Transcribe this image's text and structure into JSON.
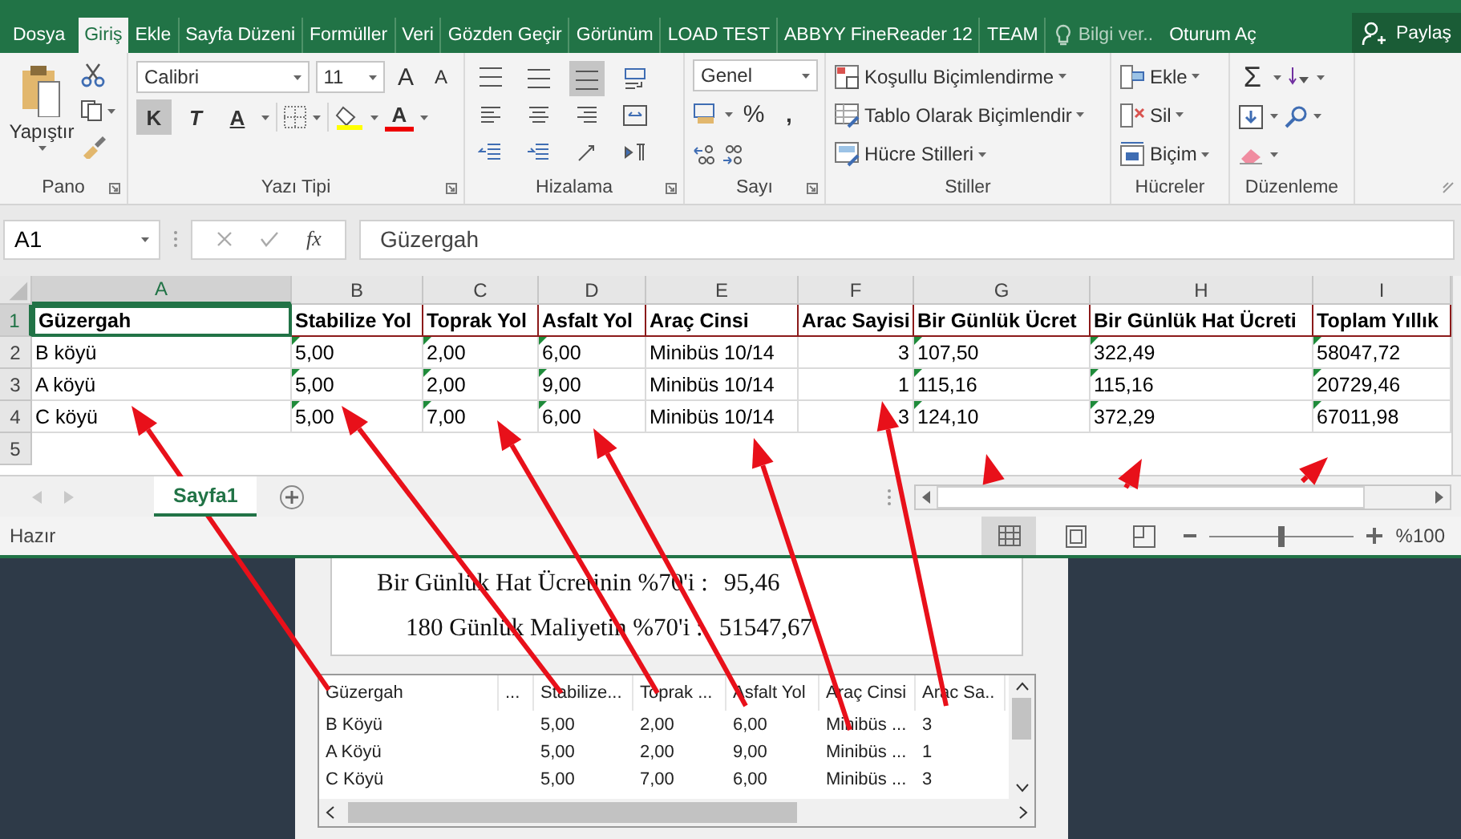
{
  "menu_tabs": [
    {
      "label": "Dosya",
      "selected": false
    },
    {
      "label": "Giriş",
      "selected": true
    },
    {
      "label": "Ekle",
      "selected": false
    },
    {
      "label": "Sayfa Düzeni",
      "selected": false
    },
    {
      "label": "Formüller",
      "selected": false
    },
    {
      "label": "Veri",
      "selected": false
    },
    {
      "label": "Gözden Geçir",
      "selected": false
    },
    {
      "label": "Görünüm",
      "selected": false
    },
    {
      "label": "LOAD TEST",
      "selected": false
    },
    {
      "label": "ABBYY FineReader 12",
      "selected": false
    },
    {
      "label": "TEAM",
      "selected": false
    }
  ],
  "tell_me": {
    "placeholder": "Bilgi ver.."
  },
  "sign_in": "Oturum Aç",
  "share": "Paylaş",
  "ribbon": {
    "clipboard": {
      "paste": "Yapıştır",
      "label": "Pano"
    },
    "font": {
      "family": "Calibri",
      "size": "11",
      "grow": "A",
      "shrink": "A",
      "bold": {
        "text": "K",
        "on": true
      },
      "italic": {
        "text": "T",
        "on": false
      },
      "underline": {
        "text": "A",
        "on": false
      },
      "font_color": "A",
      "label": "Yazı Tipi"
    },
    "alignment": {
      "label": "Hizalama",
      "buttons": [
        {
          "kind": "top",
          "on": false
        },
        {
          "kind": "middle",
          "on": false
        },
        {
          "kind": "bottom",
          "on": true
        },
        {
          "kind": "wrap",
          "on": false
        },
        {
          "kind": "left",
          "on": false
        },
        {
          "kind": "center",
          "on": false
        },
        {
          "kind": "right",
          "on": false
        },
        {
          "kind": "merge",
          "on": false
        },
        {
          "kind": "outdent",
          "on": false
        },
        {
          "kind": "indent",
          "on": false
        },
        {
          "kind": "orientation",
          "on": false
        },
        {
          "kind": "rtl",
          "on": false
        }
      ]
    },
    "number": {
      "format": "Genel",
      "percent": "%",
      "comma": ",",
      "label": "Sayı"
    },
    "styles": {
      "buttons": [
        "Koşullu Biçimlendirme",
        "Tablo Olarak Biçimlendir",
        "Hücre Stilleri"
      ],
      "label": "Stiller"
    },
    "cells": {
      "buttons": [
        "Ekle",
        "Sil",
        "Biçim"
      ],
      "label": "Hücreler"
    },
    "editing": {
      "sum": "Σ",
      "label": "Düzenleme"
    }
  },
  "formula_bar": {
    "name_box": "A1",
    "fx": "fx",
    "value": "Güzergah"
  },
  "sheet": {
    "columns": [
      {
        "label": "A",
        "selected": true
      },
      {
        "label": "B",
        "selected": false
      },
      {
        "label": "C",
        "selected": false
      },
      {
        "label": "D",
        "selected": false
      },
      {
        "label": "E",
        "selected": false
      },
      {
        "label": "F",
        "selected": false
      },
      {
        "label": "G",
        "selected": false
      },
      {
        "label": "H",
        "selected": false
      },
      {
        "label": "I",
        "selected": false
      }
    ],
    "rows": [
      {
        "number": "1",
        "selected": true,
        "kind": "header",
        "cells": [
          {
            "text": "Güzergah",
            "flag": false,
            "kind": "text"
          },
          {
            "text": "Stabilize Yol",
            "flag": false,
            "kind": "text"
          },
          {
            "text": "Toprak Yol",
            "flag": false,
            "kind": "text"
          },
          {
            "text": "Asfalt Yol",
            "flag": false,
            "kind": "text"
          },
          {
            "text": "Araç Cinsi",
            "flag": false,
            "kind": "text"
          },
          {
            "text": "Arac Sayisi",
            "flag": false,
            "kind": "text"
          },
          {
            "text": "Bir Günlük Ücret",
            "flag": false,
            "kind": "text"
          },
          {
            "text": "Bir Günlük Hat Ücreti",
            "flag": false,
            "kind": "text"
          },
          {
            "text": "Toplam Yıllık",
            "flag": false,
            "kind": "text"
          }
        ]
      },
      {
        "number": "2",
        "selected": false,
        "kind": "data",
        "cells": [
          {
            "text": "B köyü",
            "flag": false,
            "kind": "text"
          },
          {
            "text": "5,00",
            "flag": true,
            "kind": "text"
          },
          {
            "text": "2,00",
            "flag": true,
            "kind": "text"
          },
          {
            "text": "6,00",
            "flag": true,
            "kind": "text"
          },
          {
            "text": "Minibüs 10/14",
            "flag": false,
            "kind": "text"
          },
          {
            "text": "3",
            "flag": false,
            "kind": "number"
          },
          {
            "text": "107,50",
            "flag": true,
            "kind": "text"
          },
          {
            "text": "322,49",
            "flag": true,
            "kind": "text"
          },
          {
            "text": "58047,72",
            "flag": true,
            "kind": "text"
          }
        ]
      },
      {
        "number": "3",
        "selected": false,
        "kind": "data",
        "cells": [
          {
            "text": "A köyü",
            "flag": false,
            "kind": "text"
          },
          {
            "text": "5,00",
            "flag": true,
            "kind": "text"
          },
          {
            "text": "2,00",
            "flag": true,
            "kind": "text"
          },
          {
            "text": "9,00",
            "flag": true,
            "kind": "text"
          },
          {
            "text": "Minibüs 10/14",
            "flag": false,
            "kind": "text"
          },
          {
            "text": "1",
            "flag": false,
            "kind": "number"
          },
          {
            "text": "115,16",
            "flag": true,
            "kind": "text"
          },
          {
            "text": "115,16",
            "flag": true,
            "kind": "text"
          },
          {
            "text": "20729,46",
            "flag": true,
            "kind": "text"
          }
        ]
      },
      {
        "number": "4",
        "selected": false,
        "kind": "data",
        "cells": [
          {
            "text": "C köyü",
            "flag": false,
            "kind": "text"
          },
          {
            "text": "5,00",
            "flag": true,
            "kind": "text"
          },
          {
            "text": "7,00",
            "flag": true,
            "kind": "text"
          },
          {
            "text": "6,00",
            "flag": true,
            "kind": "text"
          },
          {
            "text": "Minibüs 10/14",
            "flag": false,
            "kind": "text"
          },
          {
            "text": "3",
            "flag": false,
            "kind": "number"
          },
          {
            "text": "124,10",
            "flag": true,
            "kind": "text"
          },
          {
            "text": "372,29",
            "flag": true,
            "kind": "text"
          },
          {
            "text": "67011,98",
            "flag": true,
            "kind": "text"
          }
        ]
      },
      {
        "number": "5",
        "selected": false,
        "kind": "data",
        "cells": []
      }
    ]
  },
  "sheet_tabs": [
    {
      "label": "Sayfa1",
      "selected": true
    }
  ],
  "status_bar": {
    "text": "Hazır",
    "views": [
      {
        "kind": "normal",
        "selected": true
      },
      {
        "kind": "page-layout",
        "selected": false
      },
      {
        "kind": "page-break",
        "selected": false
      }
    ],
    "zoom": {
      "level": 0.5,
      "reading": "%100"
    }
  },
  "dialog": {
    "results": [
      {
        "label": "Bir Günlük Hat Ücretinin %70'i :",
        "value": "95,46"
      },
      {
        "label": "180 Günlük Maliyetin %70'i :",
        "value": "51547,67"
      }
    ],
    "list": {
      "columns": [
        "Güzergah",
        "...",
        "Stabilize...",
        "Toprak ...",
        "Asfalt Yol",
        "Araç Cinsi",
        "Arac Sa.."
      ],
      "rows": [
        [
          "B Köyü",
          "",
          "5,00",
          "2,00",
          "6,00",
          "Minibüs ...",
          "3"
        ],
        [
          "A Köyü",
          "",
          "5,00",
          "2,00",
          "9,00",
          "Minibüs ...",
          "1"
        ],
        [
          "C Köyü",
          "",
          "5,00",
          "7,00",
          "6,00",
          "Minibüs ...",
          "3"
        ]
      ]
    }
  }
}
